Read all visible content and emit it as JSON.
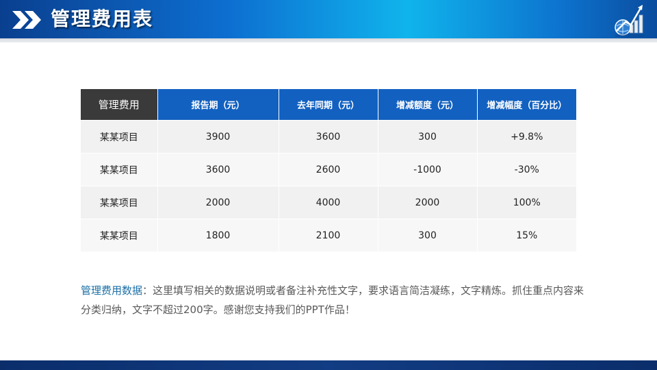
{
  "slide": {
    "title": "管理费用表",
    "colors": {
      "header_blue": "#0d6fd1",
      "header_cyan": "#10b4ec",
      "table_header_blue": "#1261c1",
      "table_header_dark": "#3a3a3a",
      "note_label": "#1a6fa6",
      "footer_navy": "#123c83"
    },
    "icons": [
      "double-chevron-right-icon",
      "globe-bar-chart-logo-icon"
    ]
  },
  "table": {
    "headers": [
      "管理费用",
      "报告期（元）",
      "去年同期（元）",
      "增减额度（元）",
      "增减幅度（百分比）"
    ],
    "rows": [
      [
        "某某项目",
        "3900",
        "3600",
        "300",
        "+9.8%"
      ],
      [
        "某某项目",
        "3600",
        "2600",
        "-1000",
        "-30%"
      ],
      [
        "某某项目",
        "2000",
        "4000",
        "2000",
        "100%"
      ],
      [
        "某某项目",
        "1800",
        "2100",
        "300",
        "15%"
      ]
    ]
  },
  "note": {
    "label": "管理费用数据",
    "text": "：这里填写相关的数据说明或者备注补充性文字，要求语言简洁凝练，文字精炼。抓住重点内容来分类归纳，文字不超过200字。感谢您支持我们的PPT作品！"
  }
}
